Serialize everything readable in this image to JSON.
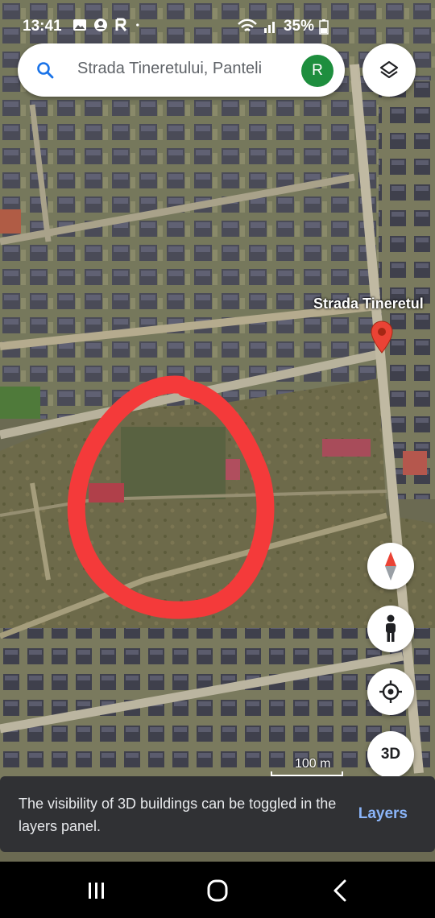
{
  "status_bar": {
    "time": "13:41",
    "left_icons": [
      "gallery-icon",
      "account-circle-icon",
      "r-app-icon",
      "dot-icon"
    ],
    "right_icons": [
      "wifi-icon",
      "signal-icon"
    ],
    "battery": "35%"
  },
  "search": {
    "icon": "search-icon",
    "query": "Strada Tineretului, Panteli",
    "avatar_initial": "R",
    "avatar_color": "#1e8e3e"
  },
  "map": {
    "place_label": "Strada Tineretul",
    "pin_color": "#ea4335",
    "annotation_color": "#f43a3a",
    "scale_label": "100 m"
  },
  "controls": {
    "layers": "layers-icon",
    "compass": "compass-icon",
    "street_view": "pegman-icon",
    "my_location": "my-location-icon",
    "three_d_label": "3D"
  },
  "snackbar": {
    "message": "The visibility of 3D buildings can be toggled in the layers panel.",
    "action_label": "Layers",
    "action_color": "#8ab4f8"
  },
  "nav_bar": {
    "buttons": [
      "recents-icon",
      "home-icon",
      "back-icon"
    ]
  }
}
